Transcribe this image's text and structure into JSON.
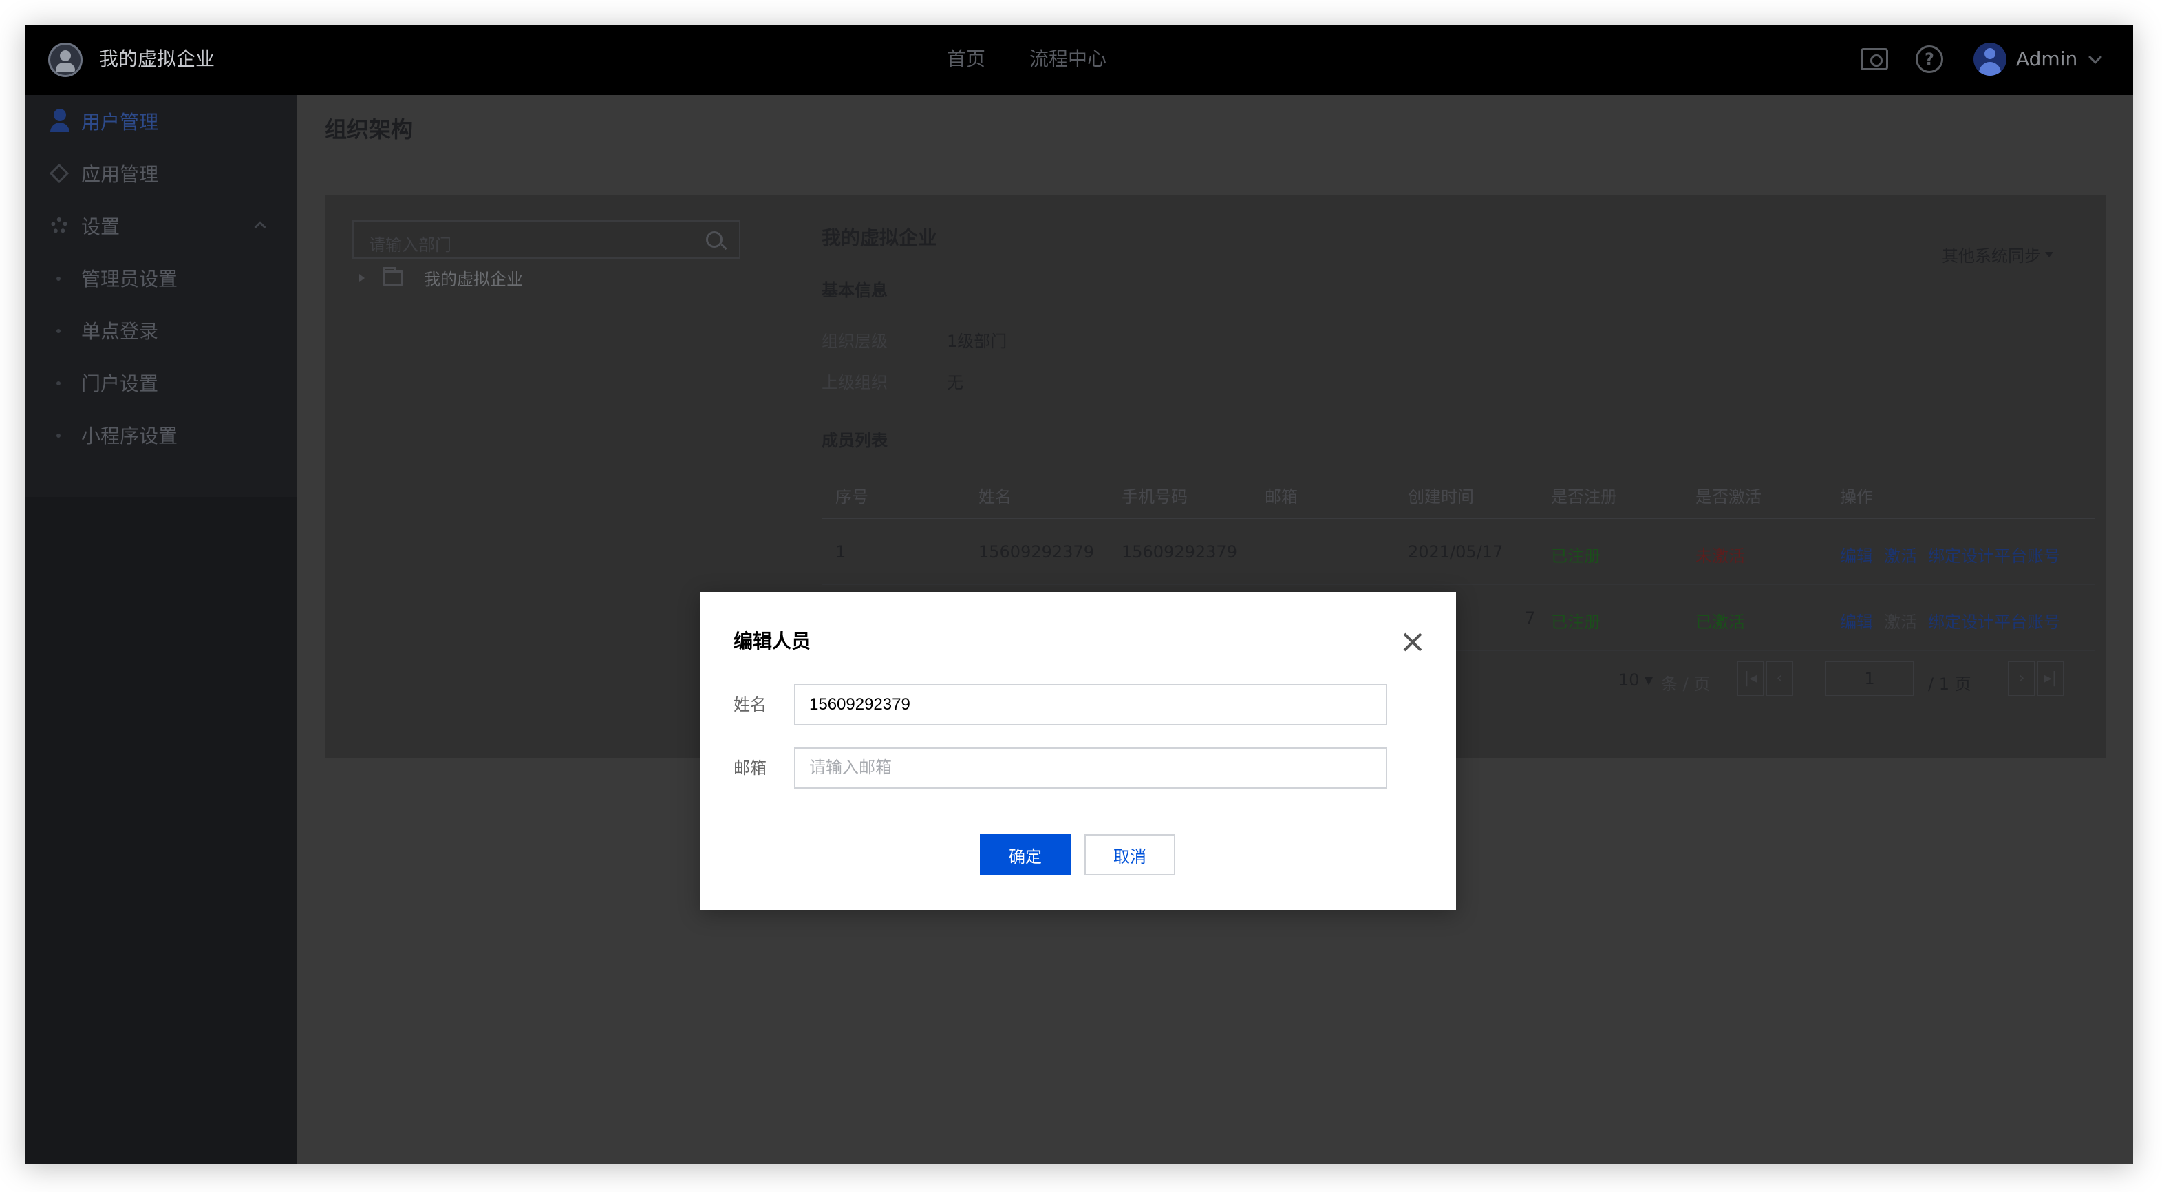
{
  "header": {
    "brand_name": "我的虚拟企业",
    "nav": [
      "首页",
      "流程中心"
    ],
    "user_name": "Admin"
  },
  "sidebar": {
    "items": [
      {
        "label": "用户管理",
        "icon": "user-icon"
      },
      {
        "label": "应用管理",
        "icon": "app-icon"
      },
      {
        "label": "设置",
        "icon": "gear-icon"
      }
    ],
    "settings_children": [
      "管理员设置",
      "单点登录",
      "门户设置",
      "小程序设置"
    ]
  },
  "main": {
    "page_title": "组织架构",
    "tree": {
      "search_placeholder": "请输入部门",
      "root": "我的虚拟企业"
    },
    "detail": {
      "title": "我的虚拟企业",
      "sync_label": "其他系统同步",
      "basic_info_title": "基本信息",
      "info": [
        {
          "label": "组织层级",
          "value": "1级部门"
        },
        {
          "label": "上级组织",
          "value": "无"
        }
      ],
      "members_title": "成员列表",
      "columns": [
        "序号",
        "姓名",
        "手机号码",
        "邮箱",
        "创建时间",
        "是否注册",
        "是否激活",
        "操作"
      ],
      "rows": [
        {
          "index": "1",
          "name": "15609292379",
          "phone": "15609292379",
          "email": "",
          "created": "2021/05/17",
          "registered": "已注册",
          "activated": "未激活",
          "actions": [
            "编辑",
            "激活",
            "绑定设计平台账号"
          ]
        },
        {
          "index": "",
          "name": "",
          "phone": "",
          "email": "",
          "created": "7",
          "registered": "已注册",
          "activated": "已激活",
          "actions": [
            "编辑",
            "激活",
            "绑定设计平台账号"
          ]
        }
      ],
      "pager": {
        "page_size": "10",
        "unit": "条 / 页",
        "current_page": "1",
        "total": "/ 1 页"
      }
    }
  },
  "modal": {
    "title": "编辑人员",
    "name_label": "姓名",
    "name_value": "15609292379",
    "email_label": "邮箱",
    "email_placeholder": "请输入邮箱",
    "ok_label": "确定",
    "cancel_label": "取消"
  }
}
